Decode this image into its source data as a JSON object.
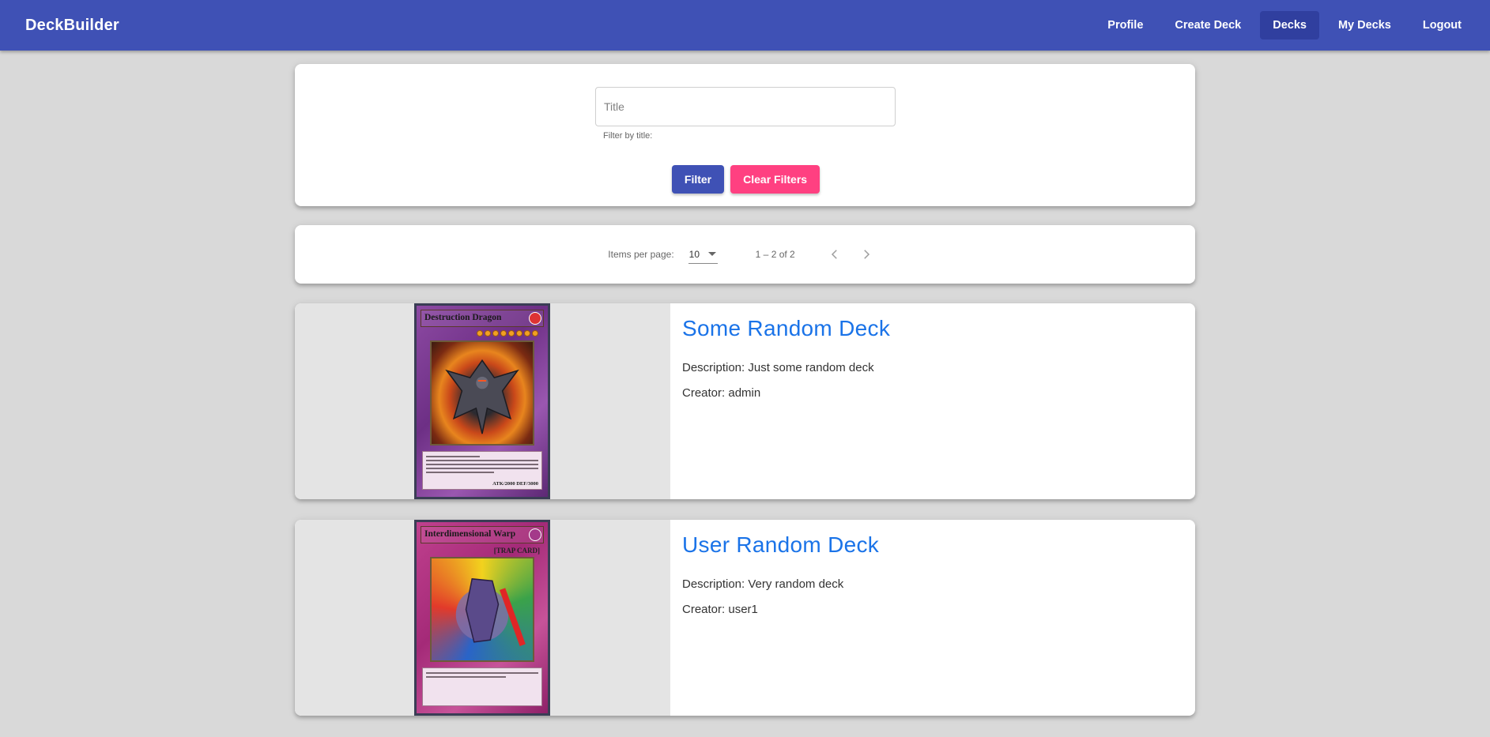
{
  "app": {
    "brand": "DeckBuilder"
  },
  "nav": {
    "items": [
      {
        "label": "Profile",
        "active": false
      },
      {
        "label": "Create Deck",
        "active": false
      },
      {
        "label": "Decks",
        "active": true
      },
      {
        "label": "My Decks",
        "active": false
      },
      {
        "label": "Logout",
        "active": false
      }
    ]
  },
  "filter": {
    "title_placeholder": "Title",
    "title_value": "",
    "hint": "Filter by title:",
    "filter_label": "Filter",
    "clear_label": "Clear Filters"
  },
  "paginator": {
    "items_per_page_label": "Items per page:",
    "page_size": "10",
    "range": "1 – 2 of 2",
    "prev_icon": "chevron-left-icon",
    "next_icon": "chevron-right-icon"
  },
  "decks": [
    {
      "title": "Some Random Deck",
      "description": "Description: Just some random deck",
      "creator": "Creator: admin",
      "card_name": "Destruction Dragon",
      "card_type": "monster-card",
      "card_stats": "ATK/2000  DEF/3000"
    },
    {
      "title": "User Random Deck",
      "description": "Description: Very random deck",
      "creator": "Creator: user1",
      "card_name": "Interdimensional Warp",
      "card_type": "trap-card",
      "card_subtype": "[TRAP CARD]"
    }
  ],
  "colors": {
    "primary": "#3f51b5",
    "primary_dark": "#303f9f",
    "accent": "#ff4081",
    "deck_title": "#1a73e8",
    "background": "#d9d9d9"
  }
}
